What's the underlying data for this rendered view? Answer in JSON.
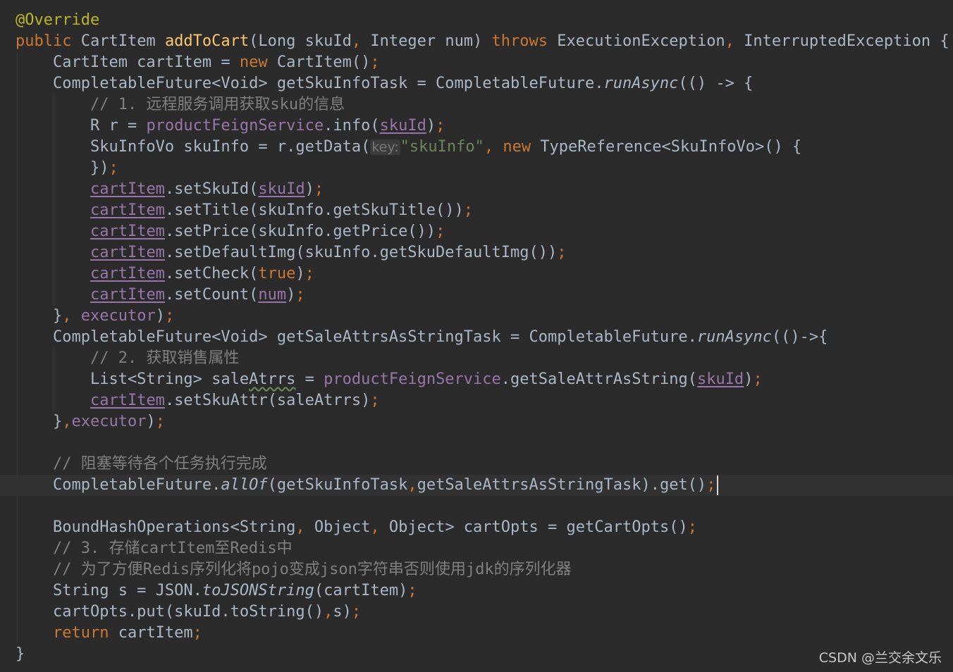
{
  "editor": {
    "theme": "darcula",
    "colors": {
      "background": "#2b2b2b",
      "current_line": "#323232",
      "default": "#a9b7c6",
      "keyword": "#cc7832",
      "method_decl": "#ffc66d",
      "string": "#6a8759",
      "comment": "#808080",
      "annotation": "#bbb529",
      "field": "#9876aa"
    },
    "current_line_index": 22,
    "lines": [
      [
        [
          "@Override",
          "ann"
        ]
      ],
      [
        [
          "public ",
          "kw"
        ],
        [
          "CartItem "
        ],
        [
          "addToCart",
          "fn"
        ],
        [
          "(Long skuId"
        ],
        [
          ", ",
          "kw"
        ],
        [
          "Integer num) "
        ],
        [
          "throws ",
          "kw"
        ],
        [
          "ExecutionException"
        ],
        [
          ", ",
          "kw"
        ],
        [
          "InterruptedException {"
        ]
      ],
      [
        [
          "    CartItem cartItem = "
        ],
        [
          "new ",
          "kw"
        ],
        [
          "CartItem()"
        ],
        [
          ";",
          "kw"
        ]
      ],
      [
        [
          "    CompletableFuture<Void> getSkuInfoTask = CompletableFuture."
        ],
        [
          "runAsync",
          "it"
        ],
        [
          "(() -> {"
        ]
      ],
      [
        [
          "        // 1. 远程服务调用获取sku的信息",
          "cmt"
        ]
      ],
      [
        [
          "        R r = "
        ],
        [
          "productFeignService",
          "fld"
        ],
        [
          ".info("
        ],
        [
          "skuId",
          "fld ul"
        ],
        [
          ")"
        ],
        [
          ";",
          "kw"
        ]
      ],
      [
        [
          "        SkuInfoVo skuInfo = r.getData("
        ],
        [
          "key:",
          "hint"
        ],
        [
          "\"skuInfo\"",
          "str"
        ],
        [
          ", ",
          "kw"
        ],
        [
          "new ",
          "kw"
        ],
        [
          "TypeReference<SkuInfoVo>() {"
        ]
      ],
      [
        [
          "        })"
        ],
        [
          ";",
          "kw"
        ]
      ],
      [
        [
          "        "
        ],
        [
          "cartItem",
          "fld ul"
        ],
        [
          ".setSkuId("
        ],
        [
          "skuId",
          "fld ul"
        ],
        [
          ")"
        ],
        [
          ";",
          "kw"
        ]
      ],
      [
        [
          "        "
        ],
        [
          "cartItem",
          "fld ul"
        ],
        [
          ".setTitle(skuInfo.getSkuTitle())"
        ],
        [
          ";",
          "kw"
        ]
      ],
      [
        [
          "        "
        ],
        [
          "cartItem",
          "fld ul"
        ],
        [
          ".setPrice(skuInfo.getPrice())"
        ],
        [
          ";",
          "kw"
        ]
      ],
      [
        [
          "        "
        ],
        [
          "cartItem",
          "fld ul"
        ],
        [
          ".setDefaultImg(skuInfo.getSkuDefaultImg())"
        ],
        [
          ";",
          "kw"
        ]
      ],
      [
        [
          "        "
        ],
        [
          "cartItem",
          "fld ul"
        ],
        [
          ".setCheck("
        ],
        [
          "true",
          "kw"
        ],
        [
          ")"
        ],
        [
          ";",
          "kw"
        ]
      ],
      [
        [
          "        "
        ],
        [
          "cartItem",
          "fld ul"
        ],
        [
          ".setCount("
        ],
        [
          "num",
          "fld ul"
        ],
        [
          ")"
        ],
        [
          ";",
          "kw"
        ]
      ],
      [
        [
          "    }"
        ],
        [
          ", ",
          "kw"
        ],
        [
          "executor",
          "fld"
        ],
        [
          ")"
        ],
        [
          ";",
          "kw"
        ]
      ],
      [
        [
          "    CompletableFuture<Void> getSaleAttrsAsStringTask = CompletableFuture."
        ],
        [
          "runAsync",
          "it"
        ],
        [
          "(()->{"
        ]
      ],
      [
        [
          "        // 2. 获取销售属性",
          "cmt"
        ]
      ],
      [
        [
          "        List<String> sale"
        ],
        [
          "Atrrs",
          "wavy"
        ],
        [
          " = "
        ],
        [
          "productFeignService",
          "fld"
        ],
        [
          ".getSaleAttrAsString("
        ],
        [
          "skuId",
          "fld ul"
        ],
        [
          ")"
        ],
        [
          ";",
          "kw"
        ]
      ],
      [
        [
          "        "
        ],
        [
          "cartItem",
          "fld ul"
        ],
        [
          ".setSkuAttr(saleAtrrs)"
        ],
        [
          ";",
          "kw"
        ]
      ],
      [
        [
          "    }"
        ],
        [
          ",",
          "kw"
        ],
        [
          "executor",
          "fld"
        ],
        [
          ")"
        ],
        [
          ";",
          "kw"
        ]
      ],
      [
        [
          ""
        ]
      ],
      [
        [
          "    // 阻塞等待各个任务执行完成",
          "cmt"
        ]
      ],
      [
        [
          "    CompletableFuture."
        ],
        [
          "allOf",
          "it"
        ],
        [
          "(getSkuInfoTask"
        ],
        [
          ",",
          "kw"
        ],
        [
          "getSaleAttrsAsStringTask).get()"
        ],
        [
          ";",
          "kw"
        ]
      ],
      [
        [
          ""
        ]
      ],
      [
        [
          "    BoundHashOperations<String"
        ],
        [
          ", ",
          "kw"
        ],
        [
          "Object"
        ],
        [
          ", ",
          "kw"
        ],
        [
          "Object> cartOpts = getCartOpts()"
        ],
        [
          ";",
          "kw"
        ]
      ],
      [
        [
          "    // 3. 存储cartItem至Redis中",
          "cmt"
        ]
      ],
      [
        [
          "    // 为了方便Redis序列化将pojo变成json字符串否则使用jdk的序列化器",
          "cmt"
        ]
      ],
      [
        [
          "    String s = JSON."
        ],
        [
          "toJSONString",
          "it"
        ],
        [
          "(cartItem)"
        ],
        [
          ";",
          "kw"
        ]
      ],
      [
        [
          "    cartOpts.put(skuId.toString()"
        ],
        [
          ",",
          "kw"
        ],
        [
          "s)"
        ],
        [
          ";",
          "kw"
        ]
      ],
      [
        [
          "    "
        ],
        [
          "return ",
          "kw"
        ],
        [
          "cartItem"
        ],
        [
          ";",
          "kw"
        ]
      ],
      [
        [
          "}"
        ]
      ]
    ]
  },
  "watermark": "CSDN @兰交余文乐"
}
